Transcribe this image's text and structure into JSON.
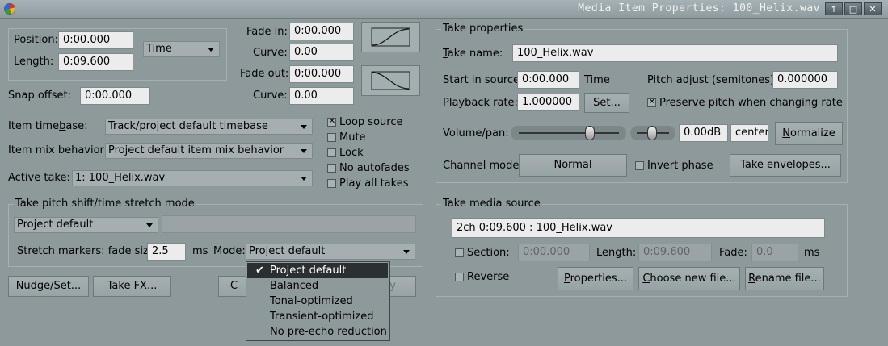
{
  "window": {
    "title": "Media Item Properties:  100_Helix.wav",
    "buttons": [
      "↑",
      "□",
      "✕"
    ]
  },
  "item": {
    "position_label": "Position:",
    "position_value": "0:00.000",
    "length_label": "Length:",
    "length_value": "0:09.600",
    "time_format": "Time",
    "fade_in_label": "Fade in:",
    "fade_in_value": "0:00.000",
    "fade_in_curve_label": "Curve:",
    "fade_in_curve_value": "0.00",
    "fade_out_label": "Fade out:",
    "fade_out_value": "0:00.000",
    "fade_out_curve_label": "Curve:",
    "fade_out_curve_value": "0.00",
    "snap_offset_label": "Snap offset:",
    "snap_offset_value": "0:00.000",
    "timebase_label": "Item timebase:",
    "timebase_value": "Track/project default timebase",
    "mix_label": "Item mix behavior:",
    "mix_value": "Project default item mix behavior",
    "active_take_label": "Active take:",
    "active_take_value": "1: 100_Helix.wav"
  },
  "flags": [
    {
      "label": "Loop source",
      "checked": true
    },
    {
      "label": "Mute",
      "checked": false
    },
    {
      "label": "Lock",
      "checked": false
    },
    {
      "label": "No autofades",
      "checked": false
    },
    {
      "label": "Play all takes",
      "checked": false
    }
  ],
  "pitch": {
    "group_title": "Take pitch shift/time stretch mode",
    "mode_value": "Project default",
    "stretch_label": "Stretch markers: fade size:",
    "stretch_value": "2.5",
    "ms_label": "ms",
    "mode_label": "Mode:",
    "mode2_value": "Project default",
    "dropdown_options": [
      "Project default",
      "Balanced",
      "Tonal-optimized",
      "Transient-optimized",
      "No pre-echo reduction"
    ],
    "dropdown_selected": 0
  },
  "bottom_buttons": {
    "nudge": "Nudge/Set...",
    "take_fx": "Take FX...",
    "left_partial": "C",
    "right_partial": "y"
  },
  "take": {
    "group_title": "Take properties",
    "name_label": "Take name:",
    "name_value": "100_Helix.wav",
    "start_label": "Start in source:",
    "start_value": "0:00.000",
    "start_unit": "Time",
    "pitch_label": "Pitch adjust (semitones):",
    "pitch_value": "0.000000",
    "rate_label": "Playback rate:",
    "rate_value": "1.000000",
    "rate_set": "Set...",
    "preserve_label": "Preserve pitch when changing rate",
    "preserve_checked": true,
    "volpan_label": "Volume/pan:",
    "volume_value": "0.00dB",
    "pan_value": "center",
    "normalize": "Normalize",
    "channel_label": "Channel mode:",
    "channel_value": "Normal",
    "invert_label": "Invert phase",
    "invert_checked": false,
    "envelopes": "Take envelopes..."
  },
  "source": {
    "group_title": "Take media source",
    "info": "2ch 0:09.600 : 100_Helix.wav",
    "section_label": "Section:",
    "section_checked": false,
    "section_value": "0:00.000",
    "length_label": "Length:",
    "length_value": "0:09.600",
    "fade_label": "Fade:",
    "fade_value": "0.0",
    "ms_label": "ms",
    "reverse_label": "Reverse",
    "reverse_checked": false,
    "properties": "Properties...",
    "choose": "Choose new file...",
    "rename": "Rename file..."
  },
  "colors": {
    "background": "#8e999c",
    "field": "#ececec",
    "selected": "#2b2f31"
  }
}
